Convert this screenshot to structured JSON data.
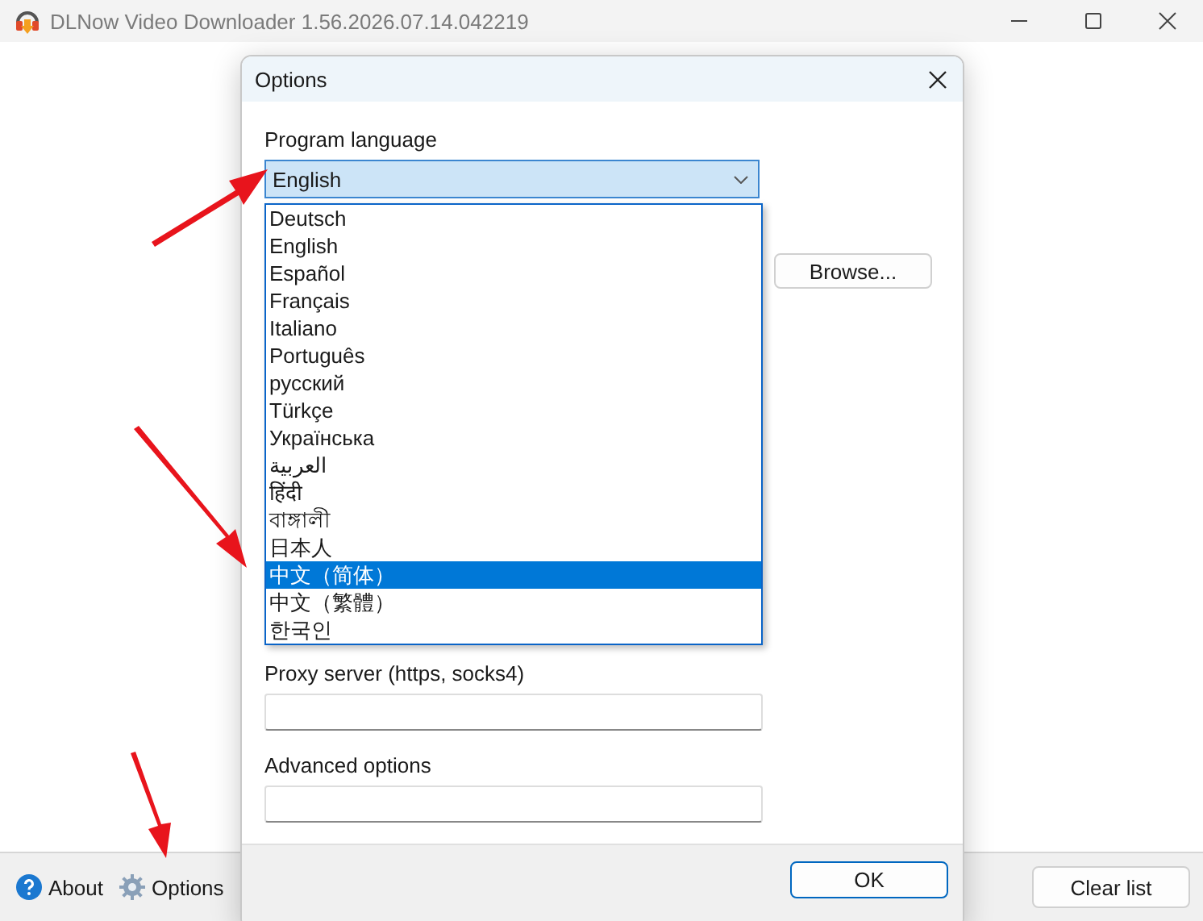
{
  "window": {
    "title": "DLNow Video Downloader 1.56.2026.07.14.042219"
  },
  "bottom_bar": {
    "buttons": [
      {
        "label": "About",
        "kind": "help"
      },
      {
        "label": "Options",
        "kind": "gear"
      }
    ],
    "clear_button": "Clear list"
  },
  "dialog": {
    "title": "Options",
    "language_label": "Program language",
    "language_value": "English",
    "language_options": [
      {
        "label": "Deutsch",
        "selected": false
      },
      {
        "label": "English",
        "selected": false
      },
      {
        "label": "Español",
        "selected": false
      },
      {
        "label": "Français",
        "selected": false
      },
      {
        "label": "Italiano",
        "selected": false
      },
      {
        "label": "Português",
        "selected": false
      },
      {
        "label": "русский",
        "selected": false
      },
      {
        "label": "Türkçe",
        "selected": false
      },
      {
        "label": "Українська",
        "selected": false
      },
      {
        "label": "العربية",
        "selected": false
      },
      {
        "label": "हिंदी",
        "selected": false
      },
      {
        "label": "বাঙ্গালী",
        "selected": false
      },
      {
        "label": "日本人",
        "selected": false
      },
      {
        "label": "中文（简体）",
        "selected": true
      },
      {
        "label": "中文（繁體）",
        "selected": false
      },
      {
        "label": "한국인",
        "selected": false
      }
    ],
    "browse_button": "Browse...",
    "proxy_label": "Proxy server (https, socks4)",
    "advanced_label": "Advanced options",
    "ok_button": "OK"
  }
}
